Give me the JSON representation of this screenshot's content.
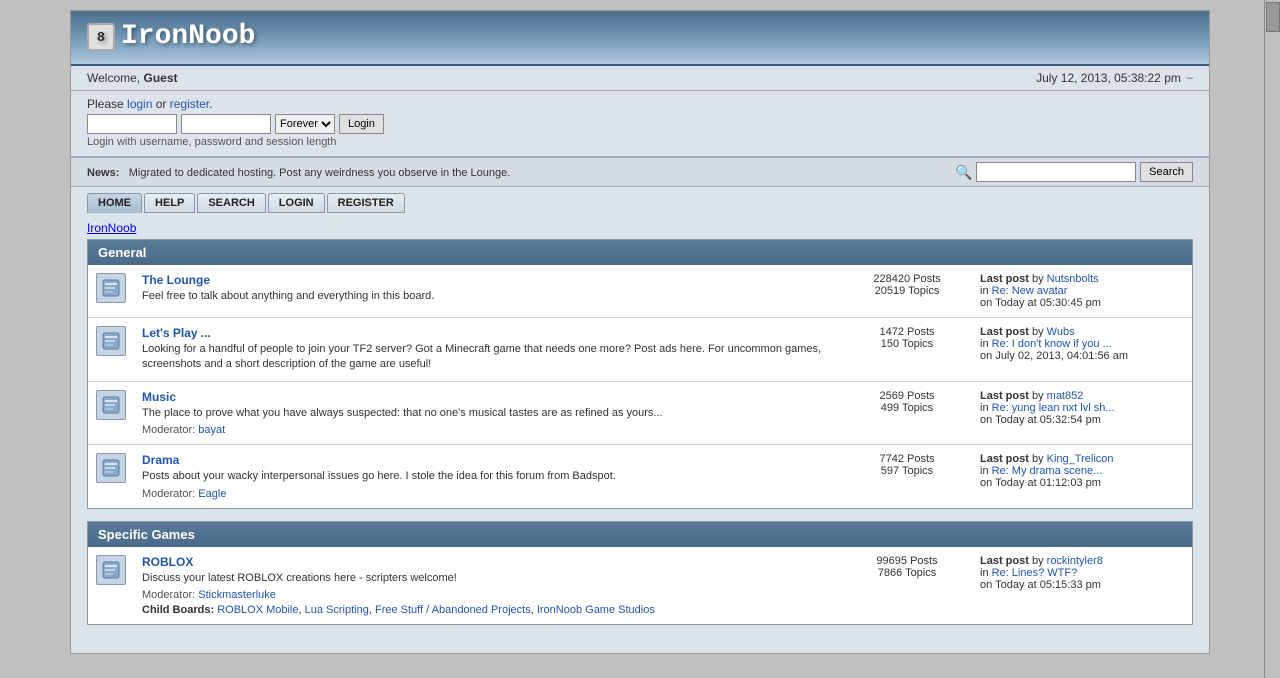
{
  "site": {
    "title": "IronNoob",
    "logo_char": "8"
  },
  "header": {
    "welcome_prefix": "Welcome,",
    "username": "Guest",
    "datetime": "July 12, 2013, 05:38:22 pm"
  },
  "login": {
    "prompt": "Please",
    "login_link": "login",
    "or_text": " or ",
    "register_link": "register",
    "period": ".",
    "session_options": [
      "Forever"
    ],
    "session_default": "Forever",
    "login_btn": "Login",
    "session_note": "Login with username, password and session length"
  },
  "news": {
    "label": "News:",
    "text": "Migrated to dedicated hosting. Post any weirdness you observe in the Lounge."
  },
  "search": {
    "placeholder": "",
    "button_label": "Search"
  },
  "nav": {
    "items": [
      {
        "label": "HOME",
        "active": true
      },
      {
        "label": "HELP",
        "active": false
      },
      {
        "label": "SEARCH",
        "active": false
      },
      {
        "label": "LOGIN",
        "active": false
      },
      {
        "label": "REGISTER",
        "active": false
      }
    ]
  },
  "breadcrumb": "IronNoob",
  "categories": [
    {
      "name": "General",
      "forums": [
        {
          "name": "The Lounge",
          "description": "Feel free to talk about anything and everything in this board.",
          "posts": "228420 Posts",
          "topics": "20519 Topics",
          "lastpost_by": "by",
          "lastpost_user": "Nutsnbolts",
          "lastpost_in": "in",
          "lastpost_thread": "Re: New avatar",
          "lastpost_on": "on",
          "lastpost_time": "Today at 05:30:45 pm",
          "moderator": null,
          "child_boards": null
        },
        {
          "name": "Let's Play ...",
          "description": "Looking for a handful of people to join your TF2 server? Got a Minecraft game that needs one more? Post ads here. For uncommon games, screenshots and a short description of the game are useful!",
          "posts": "1472 Posts",
          "topics": "150 Topics",
          "lastpost_by": "by",
          "lastpost_user": "Wubs",
          "lastpost_in": "in",
          "lastpost_thread": "Re: I don't know if you ...",
          "lastpost_on": "on",
          "lastpost_time": "July 02, 2013, 04:01:56 am",
          "moderator": null,
          "child_boards": null
        },
        {
          "name": "Music",
          "description": "The place to prove what you have always suspected: that no one's musical tastes are as refined as yours...",
          "posts": "2569 Posts",
          "topics": "499 Topics",
          "lastpost_by": "by",
          "lastpost_user": "mat852",
          "lastpost_in": "in",
          "lastpost_thread": "Re: yung lean nxt lvl sh...",
          "lastpost_on": "on",
          "lastpost_time": "Today at 05:32:54 pm",
          "moderator": "bayat",
          "child_boards": null
        },
        {
          "name": "Drama",
          "description": "Posts about your wacky interpersonal issues go here. I stole the idea for this forum from Badspot.",
          "posts": "7742 Posts",
          "topics": "597 Topics",
          "lastpost_by": "by",
          "lastpost_user": "King_Trelicon",
          "lastpost_in": "in",
          "lastpost_thread": "Re: My drama scene...",
          "lastpost_on": "on",
          "lastpost_time": "Today at 01:12:03 pm",
          "moderator": "Eagle",
          "child_boards": null
        }
      ]
    },
    {
      "name": "Specific Games",
      "forums": [
        {
          "name": "ROBLOX",
          "description": "Discuss your latest ROBLOX creations here - scripters welcome!",
          "posts": "99695 Posts",
          "topics": "7866 Topics",
          "lastpost_by": "by",
          "lastpost_user": "rockintyler8",
          "lastpost_in": "in",
          "lastpost_thread": "Re: Lines? WTF?",
          "lastpost_on": "on",
          "lastpost_time": "Today at 05:15:33 pm",
          "moderator": "Stickmasterluke",
          "child_boards": [
            {
              "label": "ROBLOX Mobile",
              "href": "#"
            },
            {
              "label": "Lua Scripting",
              "href": "#"
            },
            {
              "label": "Free Stuff / Abandoned Projects",
              "href": "#"
            },
            {
              "label": "IronNoob Game Studios",
              "href": "#"
            }
          ]
        }
      ]
    }
  ],
  "labels": {
    "moderator": "Moderator:",
    "child_boards": "Child Boards:"
  }
}
